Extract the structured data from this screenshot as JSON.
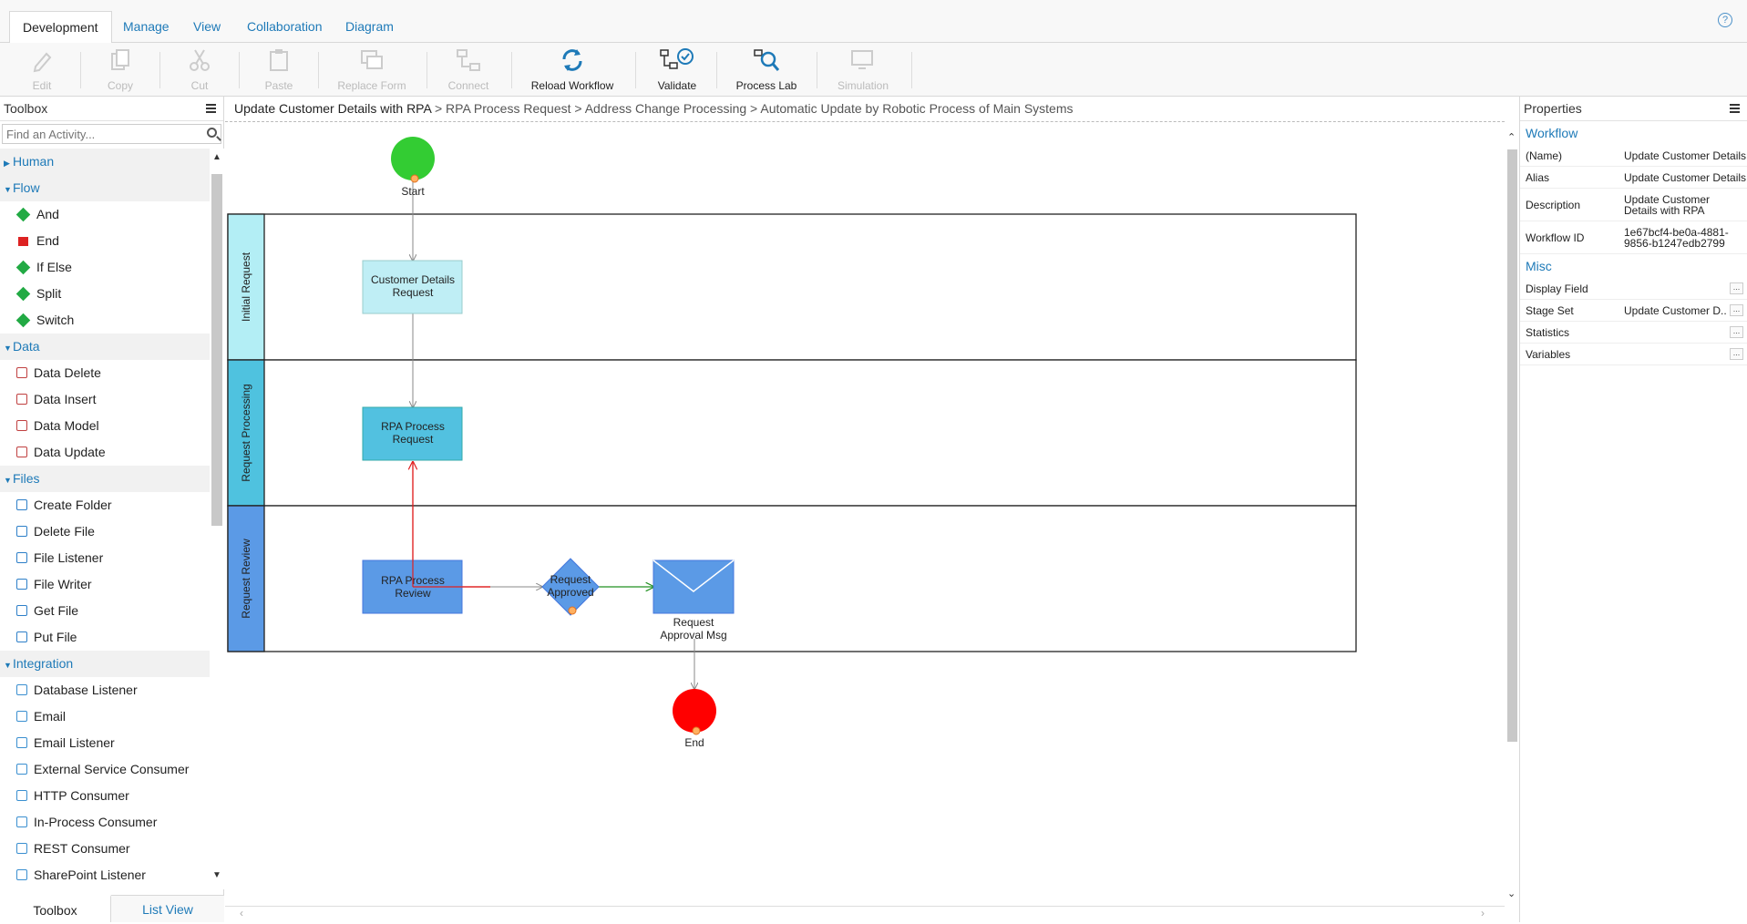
{
  "tabs": [
    "Development",
    "Manage",
    "View",
    "Collaboration",
    "Diagram"
  ],
  "ribbon": {
    "edit": "Edit",
    "copy": "Copy",
    "cut": "Cut",
    "paste": "Paste",
    "replace_form": "Replace Form",
    "connect": "Connect",
    "reload": "Reload Workflow",
    "validate": "Validate",
    "process_lab": "Process Lab",
    "simulation": "Simulation"
  },
  "toolbox": {
    "title": "Toolbox",
    "search_placeholder": "Find an Activity...",
    "categories": [
      {
        "label": "Human",
        "expanded": false,
        "items": []
      },
      {
        "label": "Flow",
        "expanded": true,
        "items": [
          "And",
          "End",
          "If Else",
          "Split",
          "Switch"
        ]
      },
      {
        "label": "Data",
        "expanded": true,
        "items": [
          "Data Delete",
          "Data Insert",
          "Data Model",
          "Data Update"
        ]
      },
      {
        "label": "Files",
        "expanded": true,
        "items": [
          "Create Folder",
          "Delete File",
          "File Listener",
          "File Writer",
          "Get File",
          "Put File"
        ]
      },
      {
        "label": "Integration",
        "expanded": true,
        "items": [
          "Database Listener",
          "Email",
          "Email Listener",
          "External Service Consumer",
          "HTTP Consumer",
          "In-Process Consumer",
          "REST Consumer",
          "SharePoint Listener"
        ]
      }
    ],
    "bottom_tabs": [
      "Toolbox",
      "List View"
    ]
  },
  "breadcrumb": {
    "parts": [
      "Update Customer Details with RPA",
      "RPA Process Request",
      "Address Change Processing",
      "Automatic Update by Robotic Process of Main Systems"
    ],
    "sep": ">"
  },
  "diagram": {
    "lanes": [
      "Initial Request",
      "Request Processing",
      "Request Review"
    ],
    "start_label": "Start",
    "end_label": "End",
    "nodes": {
      "customer_details_request": [
        "Customer Details",
        "Request"
      ],
      "rpa_process_request": [
        "RPA Process",
        "Request"
      ],
      "rpa_process_review": [
        "RPA Process",
        "Review"
      ],
      "request_approved": [
        "Request",
        "Approved"
      ],
      "request_approval_msg": [
        "Request",
        "Approval Msg"
      ]
    },
    "colors": {
      "start": "#33cc33",
      "end": "#ff0000",
      "lane1": "#b3eef5",
      "lane2": "#4fc2df",
      "lane3": "#5b9ae6",
      "node1": "#bfeef5",
      "node2": "#52c1e0",
      "node3": "#5b9ae6",
      "flow_red": "#e02020",
      "flow_green": "#209020"
    }
  },
  "properties": {
    "title": "Properties",
    "workflow_section": "Workflow",
    "rows": [
      {
        "key": "(Name)",
        "value": "Update Customer Details"
      },
      {
        "key": "Alias",
        "value": "Update Customer Details"
      },
      {
        "key": "Description",
        "value": "Update Customer Details with RPA"
      },
      {
        "key": "Workflow ID",
        "value": "1e67bcf4-be0a-4881-9856-b1247edb2799"
      }
    ],
    "misc_section": "Misc",
    "misc_rows": [
      {
        "key": "Display Field",
        "value": ""
      },
      {
        "key": "Stage Set",
        "value": "Update Customer D..."
      },
      {
        "key": "Statistics",
        "value": ""
      },
      {
        "key": "Variables",
        "value": ""
      }
    ],
    "ellipsis": "..."
  },
  "help": "?"
}
